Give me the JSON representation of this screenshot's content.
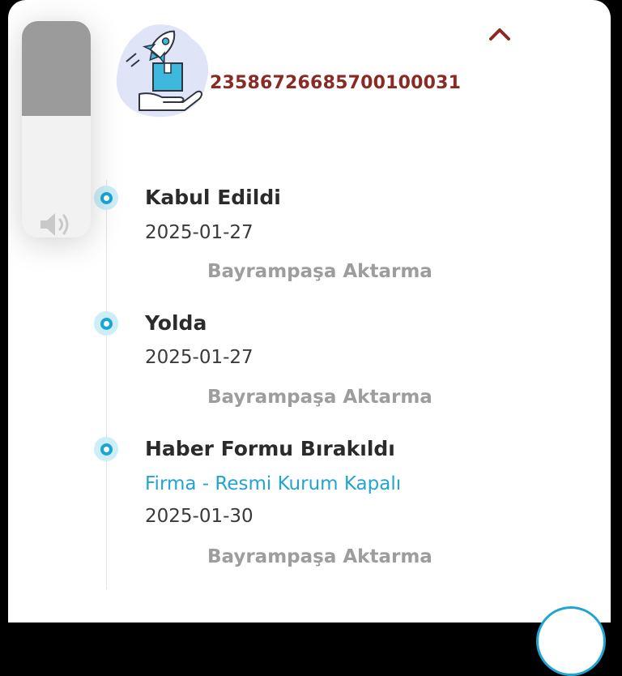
{
  "shipment": {
    "tracking_number": "2358672668570010003​1"
  },
  "timeline": [
    {
      "status": "Kabul Edildi",
      "note": "",
      "date": "2025-01-27",
      "location": "Bayrampaşa Aktarma"
    },
    {
      "status": "Yolda",
      "note": "",
      "date": "2025-01-27",
      "location": "Bayrampaşa Aktarma"
    },
    {
      "status": "Haber Formu Bırakıldı",
      "note": "Firma - Resmi Kurum Kapalı",
      "date": "2025-01-30",
      "location": "Bayrampaşa Aktarma"
    }
  ],
  "volume_hud": {
    "icon": "speaker-icon",
    "level": 0.56
  },
  "colors": {
    "accent": "#22a4d3",
    "tracking": "#8a2a25",
    "muted": "#9d9d9d"
  }
}
